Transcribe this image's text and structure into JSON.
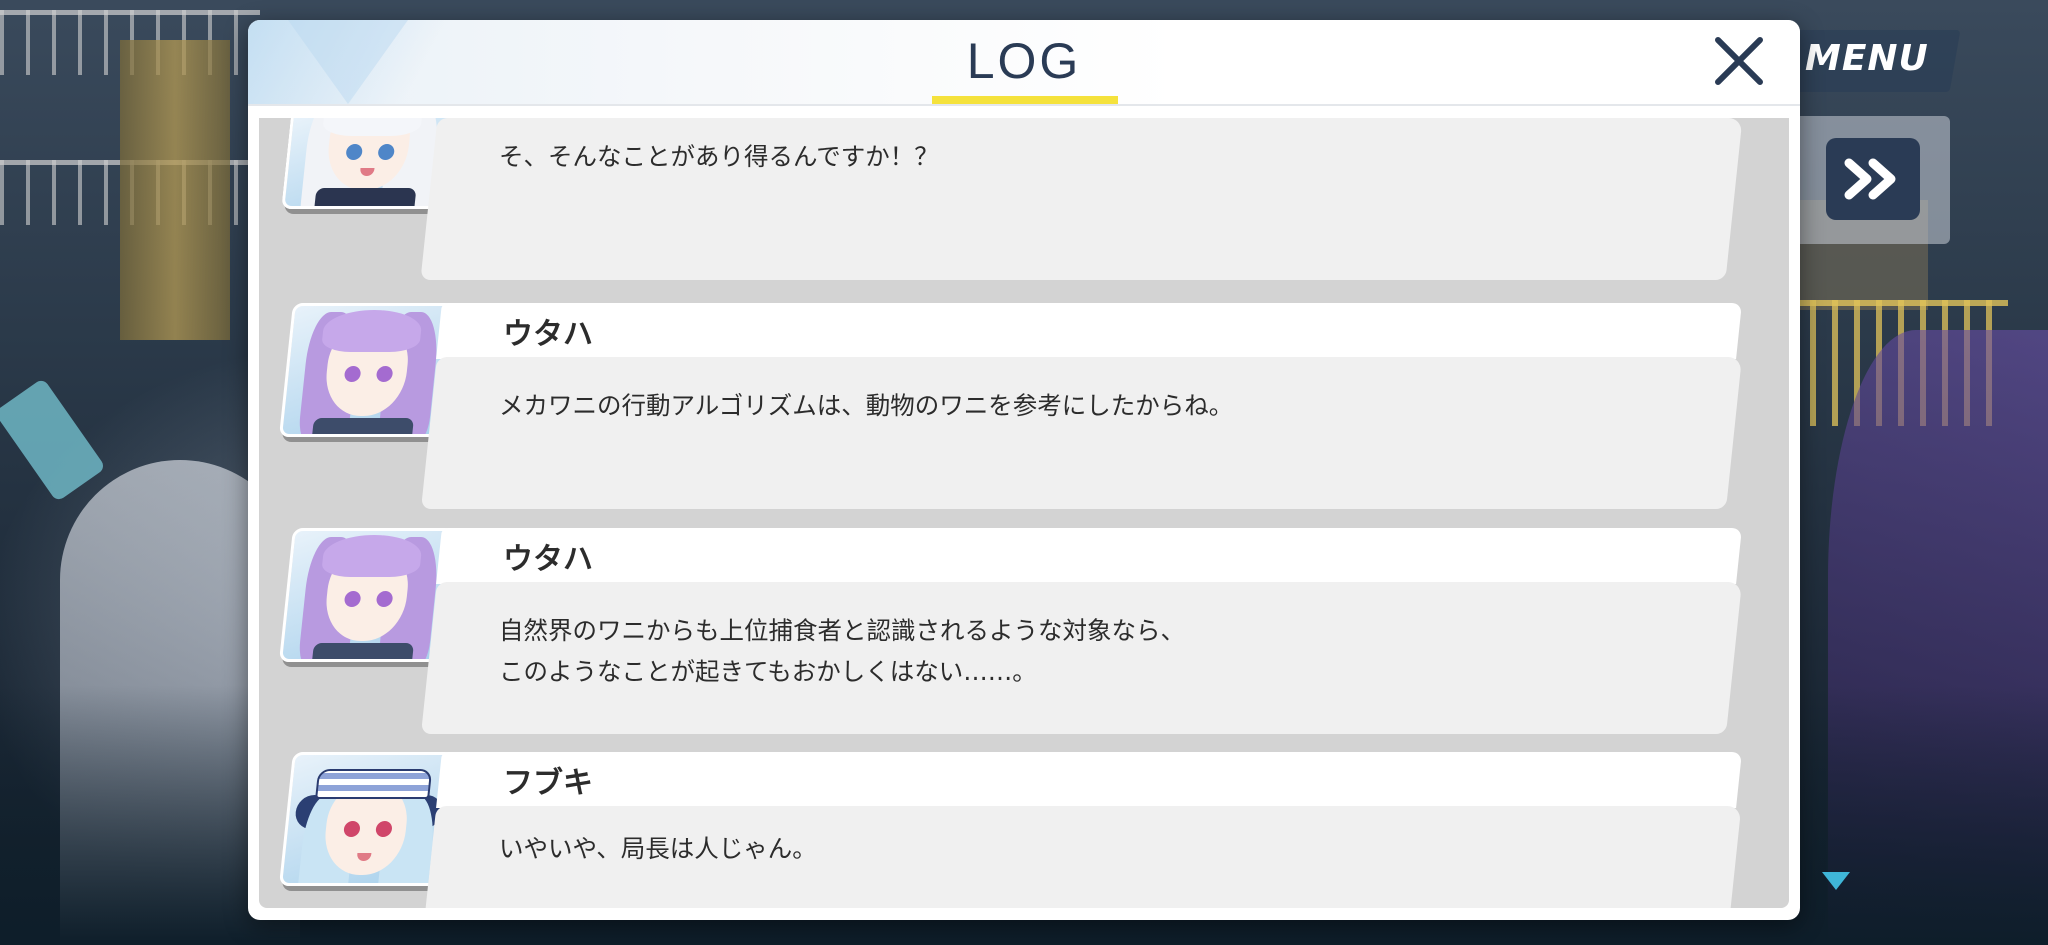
{
  "header": {
    "title": "LOG"
  },
  "controls": {
    "menu_label": "MENU",
    "fast_forward_icon": "fast-forward-icon",
    "close_icon": "close-icon"
  },
  "colors": {
    "accent_underline": "#f5e23c",
    "title_text": "#2a3b55",
    "panel_bg": "#ffffff",
    "log_bg": "#d3d3d3",
    "message_bg": "#f0f0f0"
  },
  "entries": [
    {
      "speaker": "",
      "text": "そ、そんなことがあり得るんですか！？",
      "portrait": "white-haired-girl"
    },
    {
      "speaker": "ウタハ",
      "text": "メカワニの行動アルゴリズムは、動物のワニを参考にしたからね。",
      "portrait": "utaha"
    },
    {
      "speaker": "ウタハ",
      "text": "自然界のワニからも上位捕食者と認識されるような対象なら、\nこのようなことが起きてもおかしくはない……。",
      "portrait": "utaha"
    },
    {
      "speaker": "フブキ",
      "text": "いやいや、局長は人じゃん。",
      "portrait": "fubuki"
    }
  ]
}
